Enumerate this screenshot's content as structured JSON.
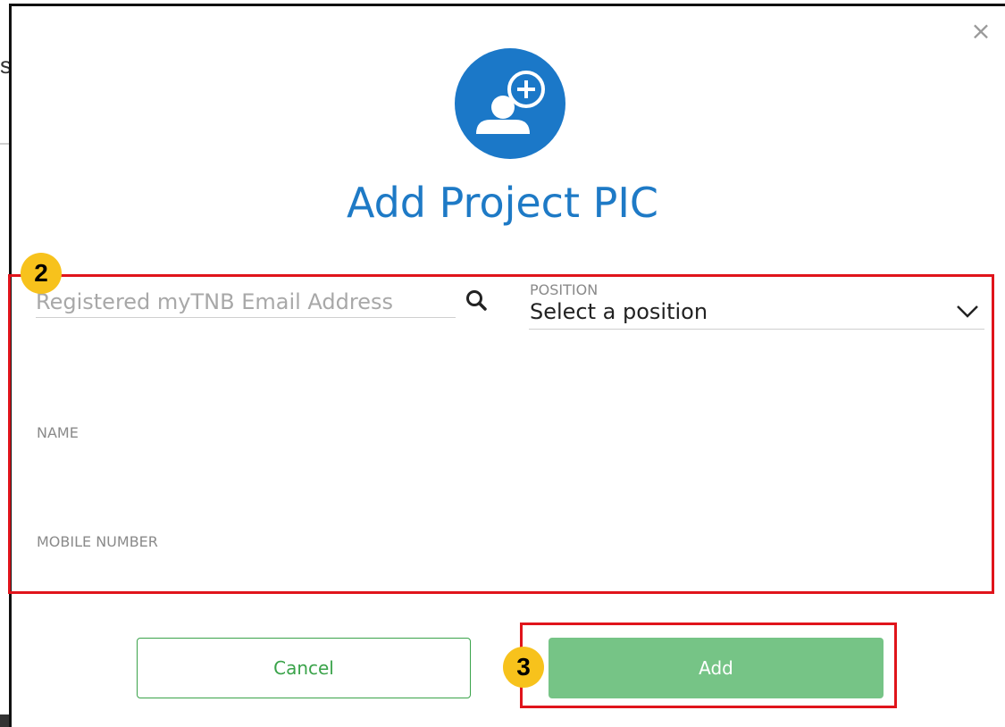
{
  "background": {
    "partial_char": "s"
  },
  "dialog": {
    "close_symbol": "×",
    "title": "Add Project PIC",
    "accent_color": "#1b78c8",
    "primary_color": "#76c486"
  },
  "form": {
    "email": {
      "placeholder": "Registered myTNB Email Address",
      "value": ""
    },
    "position": {
      "label": "POSITION",
      "selected": "Select a position"
    },
    "name": {
      "label": "NAME",
      "value": ""
    },
    "mobile": {
      "label": "MOBILE NUMBER",
      "value": ""
    }
  },
  "actions": {
    "cancel_label": "Cancel",
    "add_label": "Add"
  },
  "annotations": [
    {
      "number": "2",
      "color": "#e0141b",
      "badge_color": "#f7c21c"
    },
    {
      "number": "3",
      "color": "#e0141b",
      "badge_color": "#f7c21c"
    }
  ],
  "icons": {
    "avatar": "add-user-icon",
    "search": "search-icon",
    "chevron": "chevron-down-icon",
    "close": "close-icon"
  }
}
